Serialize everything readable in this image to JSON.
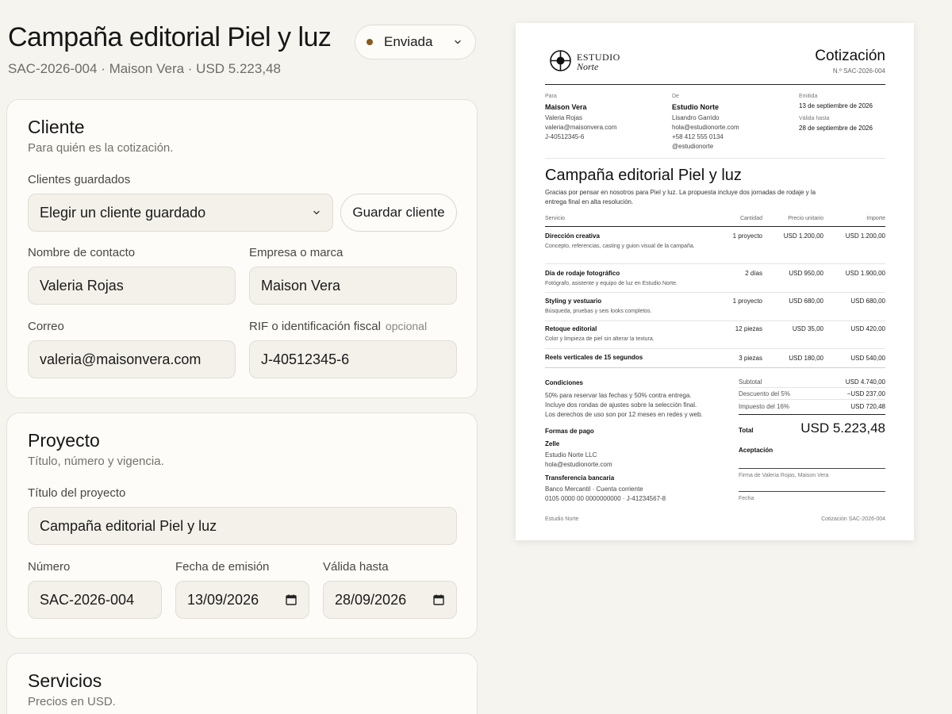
{
  "header": {
    "title": "Campaña editorial Piel y luz",
    "subtitle": "SAC-2026-004 · Maison Vera · USD 5.223,48",
    "status": "Enviada",
    "status_color": "#8a5a1e"
  },
  "client_card": {
    "title": "Cliente",
    "subtitle": "Para quién es la cotización.",
    "saved_clients_label": "Clientes guardados",
    "saved_clients_value": "Elegir un cliente guardado",
    "save_client_button": "Guardar cliente",
    "contact_label": "Nombre de contacto",
    "contact_value": "Valeria Rojas",
    "company_label": "Empresa o marca",
    "company_value": "Maison Vera",
    "email_label": "Correo",
    "email_value": "valeria@maisonvera.com",
    "tax_label": "RIF o identificación fiscal",
    "tax_optional": "opcional",
    "tax_value": "J-40512345-6"
  },
  "project_card": {
    "title": "Proyecto",
    "subtitle": "Título, número y vigencia.",
    "project_title_label": "Título del proyecto",
    "project_title_value": "Campaña editorial Piel y luz",
    "number_label": "Número",
    "number_value": "SAC-2026-004",
    "issue_label": "Fecha de emisión",
    "issue_value": "13/09/2026",
    "valid_label": "Válida hasta",
    "valid_value": "28/09/2026"
  },
  "services_card": {
    "title": "Servicios",
    "subtitle": "Precios en USD."
  },
  "doc": {
    "brand_line1": "ESTUDIO",
    "brand_line2": "Norte",
    "title": "Cotización",
    "number": "N.º SAC-2026-004",
    "to_label": "Para",
    "to_company": "Maison Vera",
    "to_contact": "Valeria Rojas",
    "to_email": "valeria@maisonvera.com",
    "to_tax": "J-40512345-6",
    "from_label": "De",
    "from_company": "Estudio Norte",
    "from_contact": "Lisandro Garrido",
    "from_email": "hola@estudionorte.com",
    "from_phone": "+58 412 555 0134",
    "from_handle": "@estudionorte",
    "issued_label": "Emitida",
    "issued_value": "13 de septiembre de 2026",
    "valid_label": "Válida hasta",
    "valid_value": "28 de septiembre de 2026",
    "project_title": "Campaña editorial Piel y luz",
    "intro": "Gracias por pensar en nosotros para Piel y luz. La propuesta incluye dos jornadas de rodaje y la entrega final en alta resolución.",
    "columns": [
      "Servicio",
      "Cantidad",
      "Precio unitario",
      "Importe"
    ],
    "items": [
      {
        "name": "Dirección creativa",
        "desc": "Concepto, referencias, casting y guion visual de la campaña.",
        "qty": "1 proyecto",
        "unit": "USD 1.200,00",
        "amount": "USD 1.200,00"
      },
      {
        "name": "Día de rodaje fotográfico",
        "desc": "Fotógrafo, asistente y equipo de luz en Estudio Norte.",
        "qty": "2 días",
        "unit": "USD 950,00",
        "amount": "USD 1.900,00"
      },
      {
        "name": "Styling y vestuario",
        "desc": "Búsqueda, pruebas y seis looks completos.",
        "qty": "1 proyecto",
        "unit": "USD 680,00",
        "amount": "USD 680,00"
      },
      {
        "name": "Retoque editorial",
        "desc": "Color y limpieza de piel sin alterar la textura.",
        "qty": "12 piezas",
        "unit": "USD 35,00",
        "amount": "USD 420,00"
      },
      {
        "name": "Reels verticales de 15 segundos",
        "desc": "",
        "qty": "3 piezas",
        "unit": "USD 180,00",
        "amount": "USD 540,00"
      }
    ],
    "conditions_title": "Condiciones",
    "conditions_text": [
      "50% para reservar las fechas y 50% contra entrega.",
      "Incluye dos rondas de ajustes sobre la selección final.",
      "Los derechos de uso son por 12 meses en redes y web."
    ],
    "payment_title": "Formas de pago",
    "payment1_name": "Zelle",
    "payment1_line1": "Estudio Norte LLC",
    "payment1_line2": "hola@estudionorte.com",
    "payment2_name": "Transferencia bancaria",
    "payment2_line1": "Banco Mercantil · Cuenta corriente",
    "payment2_line2": "0105 0000 00 0000000000 · J-41234567-8",
    "subtotal_label": "Subtotal",
    "subtotal_value": "USD 4.740,00",
    "discount_label": "Descuento del 5%",
    "discount_value": "−USD 237,00",
    "tax_label": "Impuesto del 16%",
    "tax_value": "USD 720,48",
    "total_label": "Total",
    "total_value": "USD 5.223,48",
    "acceptance_title": "Aceptación",
    "signature_label": "Firma de Valeria Rojas, Maison Vera",
    "date_label": "Fecha",
    "footer_left": "Estudio Norte",
    "footer_right": "Cotización SAC-2026-004"
  }
}
